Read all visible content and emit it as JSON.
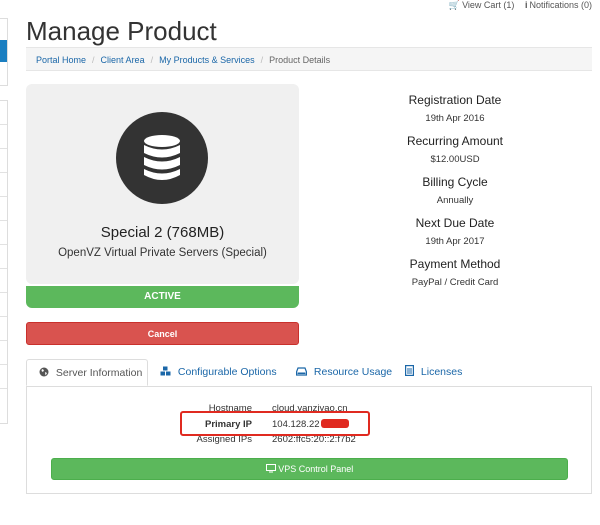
{
  "topbar": {
    "cart_label": "View Cart (1)",
    "notifications_label": "Notifications (0)"
  },
  "page": {
    "title": "Manage Product"
  },
  "breadcrumb": {
    "items": [
      "Portal Home",
      "Client Area",
      "My Products & Services"
    ],
    "current": "Product Details"
  },
  "product": {
    "name": "Special 2 (768MB)",
    "group": "OpenVZ Virtual Private Servers (Special)",
    "status": "ACTIVE",
    "icon": "database-icon",
    "cancel_label": "Cancel"
  },
  "details": {
    "registration_date": {
      "label": "Registration Date",
      "value": "19th Apr 2016"
    },
    "recurring_amount": {
      "label": "Recurring Amount",
      "value": "$12.00USD"
    },
    "billing_cycle": {
      "label": "Billing Cycle",
      "value": "Annually"
    },
    "next_due_date": {
      "label": "Next Due Date",
      "value": "19th Apr 2017"
    },
    "payment_method": {
      "label": "Payment Method",
      "value": "PayPal / Credit Card"
    }
  },
  "tabs": [
    {
      "label": "Server Information",
      "icon": "globe-icon",
      "active": true
    },
    {
      "label": "Configurable Options",
      "icon": "cubes-icon",
      "active": false
    },
    {
      "label": "Resource Usage",
      "icon": "hdd-icon",
      "active": false
    },
    {
      "label": "Licenses",
      "icon": "file-icon",
      "active": false
    }
  ],
  "server": {
    "hostname": {
      "label": "Hostname",
      "value": "cloud.yanziyao.cn"
    },
    "primary_ip": {
      "label": "Primary IP",
      "value": "104.128.22"
    },
    "assigned_ips": {
      "label": "Assigned IPs",
      "value": "2602:ffc5:20::2:f7b2"
    }
  },
  "vps_button": {
    "label": "VPS Control Panel"
  },
  "colors": {
    "link": "#1b67a8",
    "success": "#5cb85c",
    "danger": "#d9534f",
    "annotation": "#e02a20"
  }
}
